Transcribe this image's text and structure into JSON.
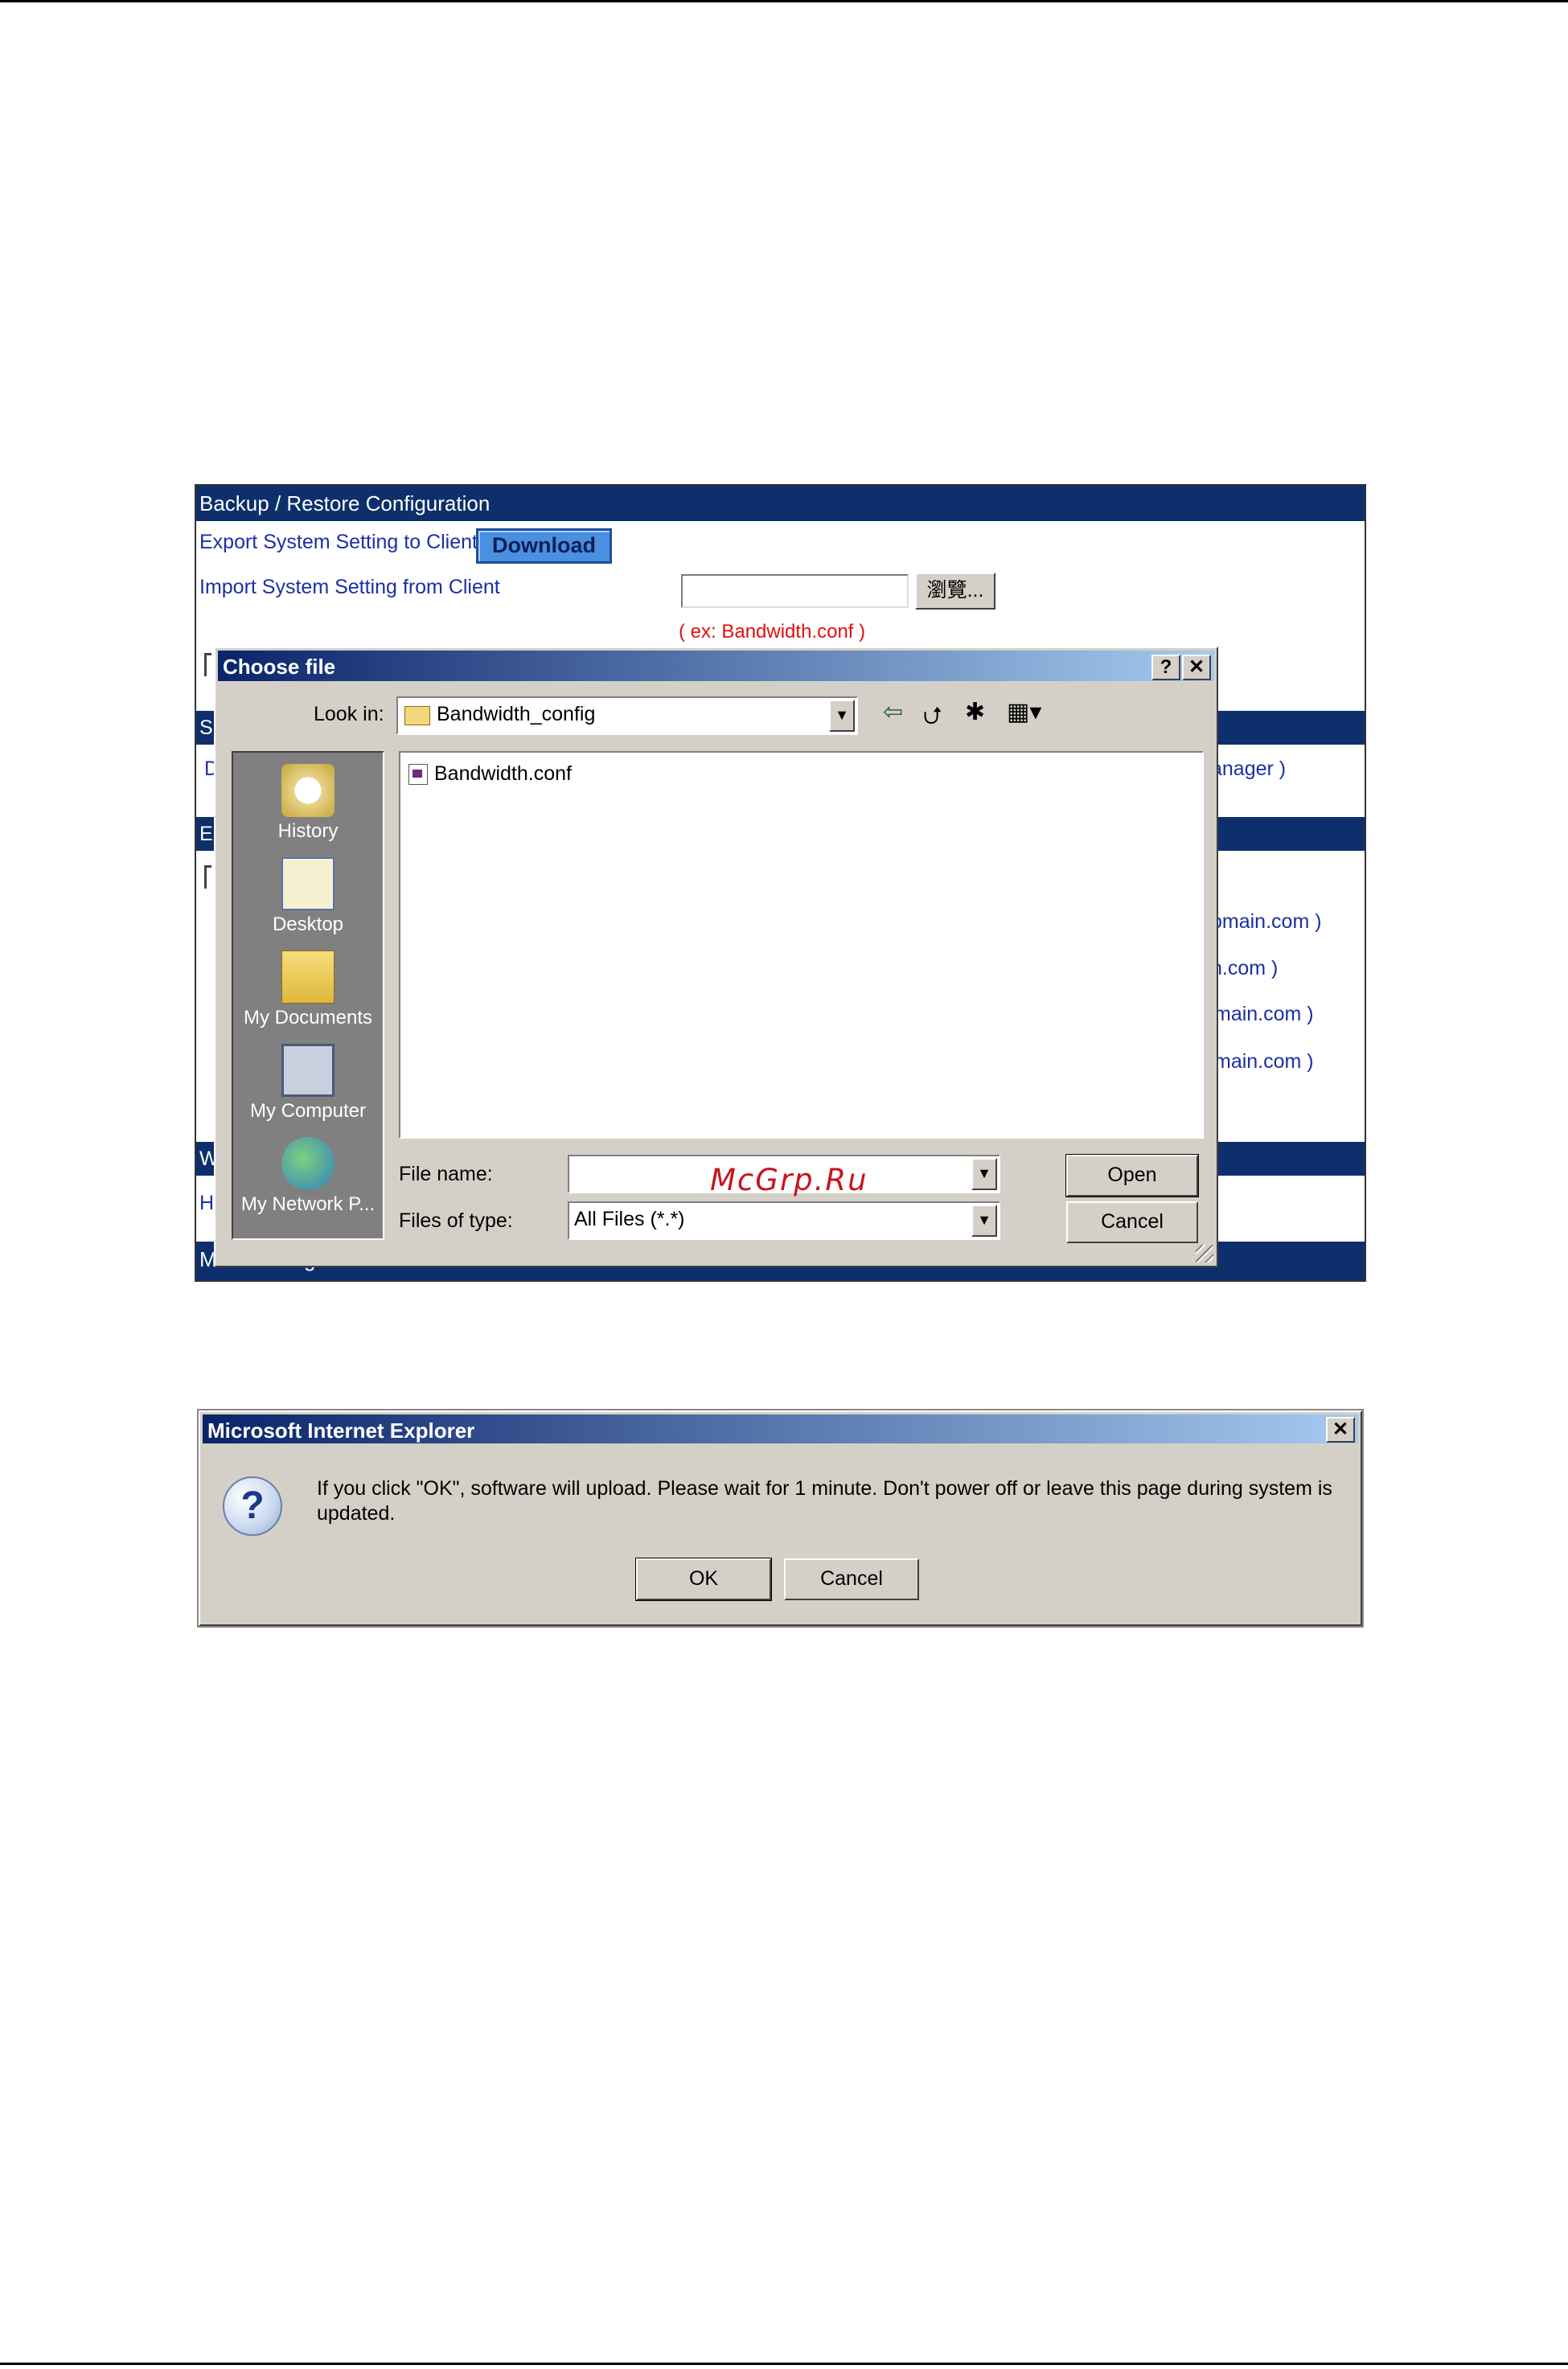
{
  "config_page": {
    "section_title": "Backup / Restore Configuration",
    "export_label": "Export System Setting to Client",
    "download_button": "Download",
    "import_label": "Import System Setting from Client",
    "browse_button": "瀏覽...",
    "example_note": "( ex: Bandwidth.conf )",
    "partial_texts": {
      "anager": "anager )",
      "omain1": "omain.com )",
      "hcom": "h.com )",
      "main1": "main.com )",
      "main2": "main.com )",
      "band_s": "S",
      "band_e": "E",
      "band_w": "W",
      "link_d": "D",
      "link_ht": "HT",
      "bottom_band": "MTU Setting"
    }
  },
  "choose_file_dialog": {
    "title": "Choose file",
    "help_button": "?",
    "close_button": "✕",
    "look_in_label": "Look in:",
    "look_in_value": "Bandwidth_config",
    "places": [
      {
        "label": "History",
        "icon": "history-icon"
      },
      {
        "label": "Desktop",
        "icon": "desktop-icon"
      },
      {
        "label": "My Documents",
        "icon": "my-documents-icon"
      },
      {
        "label": "My Computer",
        "icon": "my-computer-icon"
      },
      {
        "label": "My Network P...",
        "icon": "my-network-places-icon"
      }
    ],
    "files": [
      "Bandwidth.conf"
    ],
    "file_name_label": "File name:",
    "file_name_value": "",
    "files_of_type_label": "Files of type:",
    "files_of_type_value": "All Files (*.*)",
    "open_button": "Open",
    "cancel_button": "Cancel"
  },
  "watermark": "McGrp.Ru",
  "ie_message_box": {
    "title": "Microsoft Internet Explorer",
    "close_button": "✕",
    "icon": "question-icon",
    "message": "If you click \"OK\", software will upload.  Please wait for 1 minute.  Don't power off or leave this page during system is updated.",
    "ok_button": "OK",
    "cancel_button": "Cancel"
  },
  "colors": {
    "band": "#0d2f6b",
    "link": "#1b2fa6",
    "note": "#e01010",
    "dialog_face": "#d4d0c8",
    "title_start": "#0a246a",
    "title_end": "#a6caf0",
    "watermark": "#c8141e"
  }
}
